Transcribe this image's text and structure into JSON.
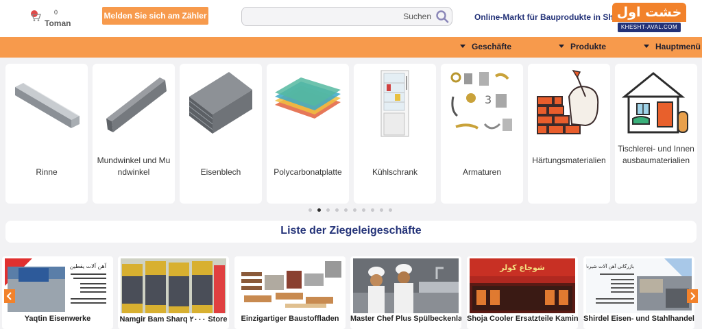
{
  "header": {
    "cart_count": "0",
    "currency": "Toman",
    "login_label": "Melden Sie sich am Zähler an.",
    "search_label": "Suchen",
    "search_value": "",
    "tagline": "Online-Markt für Bauprodukte in Shiraz",
    "logo_text": "خشت اول",
    "logo_subtext": "KHESHT-AVAL.COM"
  },
  "nav": {
    "items": [
      "Geschäfte",
      "Produkte",
      "Hauptmenü"
    ]
  },
  "categories": [
    {
      "label": "Rinne",
      "icon": "gutter-channel-icon"
    },
    {
      "label": "Mundwinkel und Mundwinkel",
      "icon": "angle-iron-icon"
    },
    {
      "label": "Eisenblech",
      "icon": "sheet-metal-icon"
    },
    {
      "label": "Polycarbonatplatte",
      "icon": "polycarbonate-sheet-icon"
    },
    {
      "label": "Kühlschrank",
      "icon": "refrigerator-icon"
    },
    {
      "label": "Armaturen",
      "icon": "fittings-icon"
    },
    {
      "label": "Härtungsmaterialien",
      "icon": "brick-wall-icon"
    },
    {
      "label": "Tischlerei- und Innenausbaumaterialien",
      "icon": "house-interior-icon"
    }
  ],
  "carousel": {
    "dot_count": 10,
    "active_index": 1
  },
  "section": {
    "title": "Liste der Ziegeleigeschäfte"
  },
  "stores": [
    {
      "name": "Yaqtin Eisenwerke"
    },
    {
      "name": "Namgir Bam Sharq ۲۰۰۰ Store"
    },
    {
      "name": "Einzigartiger Baustoffladen"
    },
    {
      "name": "Master Chef Plus Spülbeckenladen"
    },
    {
      "name": "Shoja Cooler Ersatzteile Kaminshop"
    },
    {
      "name": "Shirdel Eisen- und Stahlhandel"
    }
  ],
  "store_banner_texts": {
    "yaqtin": "آهن آلات یقطین",
    "shoja": "شوجاع کولر",
    "shirdel": "بازرگانی آهن آلات شیردل"
  },
  "colors": {
    "accent": "#f79a4c",
    "brand_dark": "#233278",
    "logo_orange": "#f2822b"
  }
}
